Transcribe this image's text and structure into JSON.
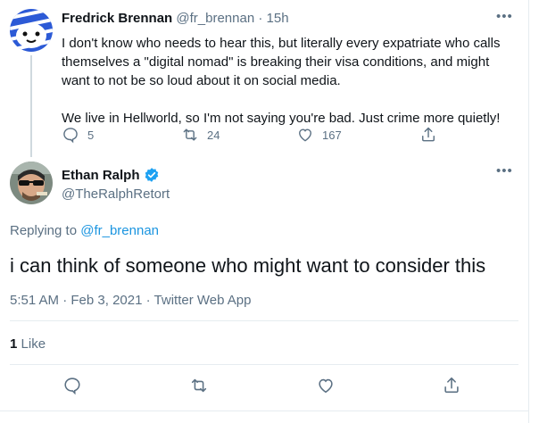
{
  "parent_tweet": {
    "name": "Fredrick Brennan",
    "handle": "@fr_brennan",
    "separator": "·",
    "time": "15h",
    "text": "I don't know who needs to hear this, but literally every expatriate who calls\nthemselves a \"digital nomad\" is breaking their visa conditions, and might\nwant to not be so loud about it on social media.\n\nWe live in Hellworld, so I'm not saying you're bad. Just crime more quietly!",
    "replies": "5",
    "retweets": "24",
    "likes": "167",
    "more": "•••"
  },
  "main_tweet": {
    "name": "Ethan Ralph",
    "handle": "@TheRalphRetort",
    "more": "•••",
    "replying_prefix": "Replying to",
    "replying_handle": "@fr_brennan",
    "text": "i can think of someone who might want to consider this",
    "time": "5:51 AM",
    "date": "Feb 3, 2021",
    "source": "Twitter Web App",
    "dot": "·",
    "like_count": "1",
    "like_label": "Like"
  },
  "colors": {
    "accent": "#1b95e0",
    "secondary_text": "#5b7083",
    "verified": "#1da1f2"
  }
}
